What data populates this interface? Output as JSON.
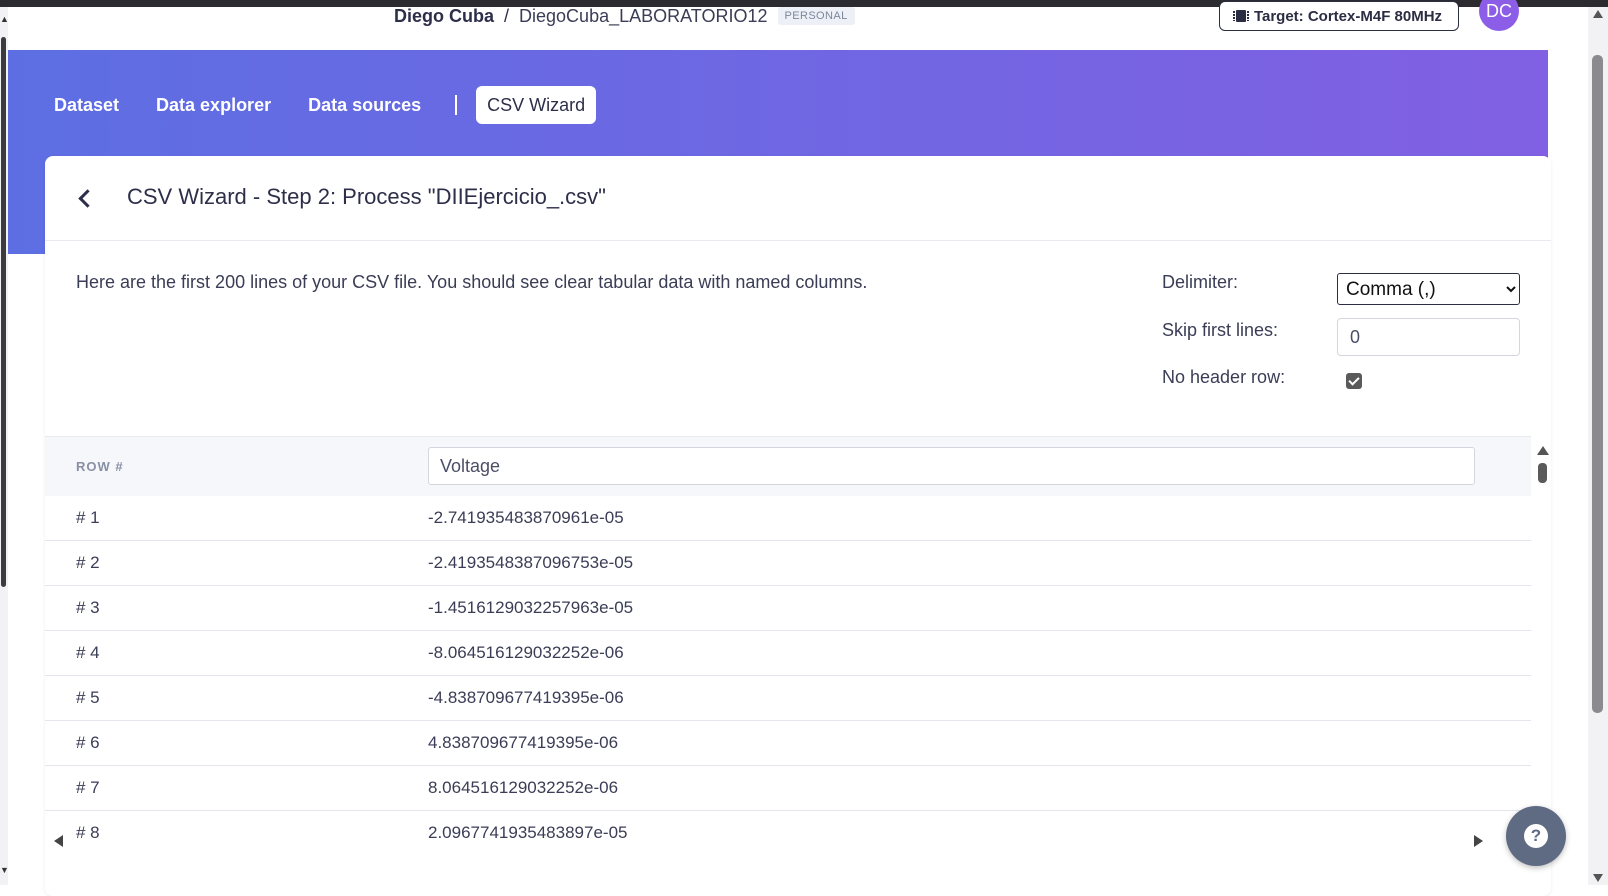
{
  "header": {
    "owner": "Diego Cuba",
    "separator": "/",
    "project": "DiegoCuba_LABORATORIO12",
    "badge": "PERSONAL",
    "target_label": "Target: Cortex-M4F 80MHz",
    "avatar_initials": "DC"
  },
  "tabs": [
    {
      "label": "Dataset",
      "active": false
    },
    {
      "label": "Data explorer",
      "active": false
    },
    {
      "label": "Data sources",
      "active": false
    },
    {
      "label": "CSV Wizard",
      "active": true
    }
  ],
  "card": {
    "title": "CSV Wizard - Step 2: Process \"DIIEjercicio_.csv\"",
    "intro": "Here are the first 200 lines of your CSV file. You should see clear tabular data with named columns."
  },
  "options": {
    "delimiter_label": "Delimiter:",
    "delimiter_value": "Comma (,)",
    "skip_label": "Skip first lines:",
    "skip_value": "0",
    "no_header_label": "No header row:",
    "no_header_checked": true
  },
  "table": {
    "row_header": "ROW #",
    "column_name": "Voltage",
    "rows": [
      {
        "index": "# 1",
        "value": "-2.741935483870961e-05"
      },
      {
        "index": "# 2",
        "value": "-2.4193548387096753e-05"
      },
      {
        "index": "# 3",
        "value": "-1.4516129032257963e-05"
      },
      {
        "index": "# 4",
        "value": "-8.064516129032252e-06"
      },
      {
        "index": "# 5",
        "value": "-4.838709677419395e-06"
      },
      {
        "index": "# 6",
        "value": "4.838709677419395e-06"
      },
      {
        "index": "# 7",
        "value": "8.064516129032252e-06"
      },
      {
        "index": "# 8",
        "value": "2.0967741935483897e-05"
      }
    ]
  },
  "colors": {
    "banner_start": "#5d6ee3",
    "banner_end": "#8160e3",
    "avatar": "#8c5ee8",
    "text": "#2d2f4a"
  },
  "icons": {
    "target": "chip-icon",
    "back": "chevron-left-icon",
    "help": "question-icon"
  }
}
